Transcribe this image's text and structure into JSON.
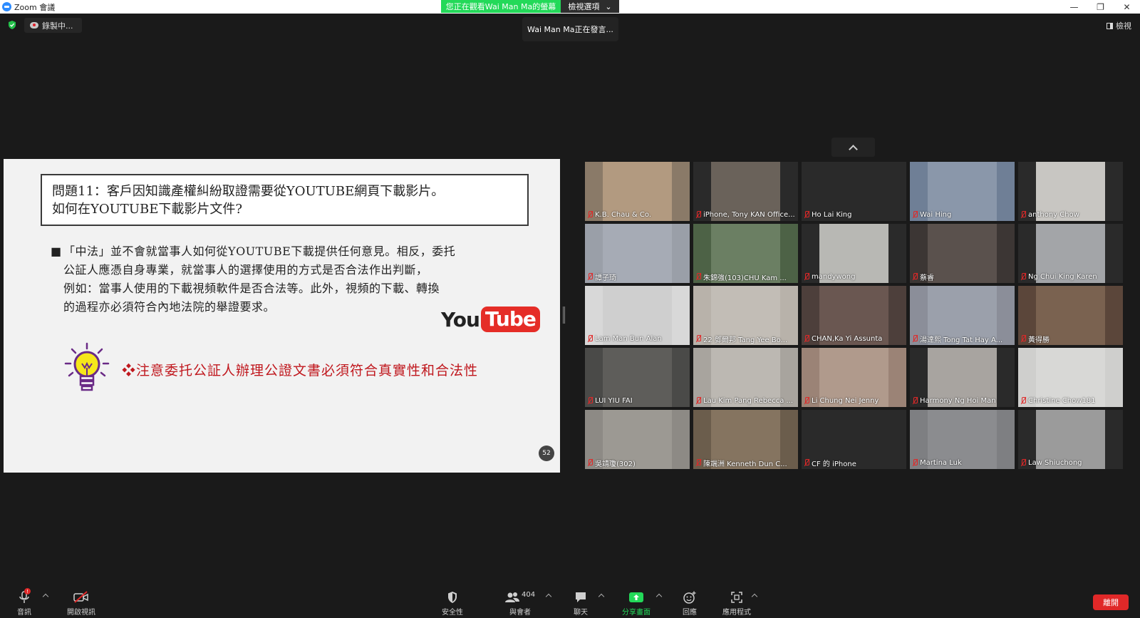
{
  "window": {
    "title": "Zoom 會議"
  },
  "banner": {
    "viewing": "您正在觀看Wai Man Ma的螢幕",
    "view_options": "檢視選項"
  },
  "speaker_tag": "Wai Man Ma正在發言...",
  "recording_label": "錄製中...",
  "view_label": "檢視",
  "slide": {
    "question_line1": "問題11：客戶因知識產權糾紛取證需要從YOUTUBE網頁下載影片。",
    "question_line2": "如何在YOUTUBE下載影片文件?",
    "bullet_mark": "■",
    "bullet_lines": [
      "「中法」並不會就當事人如何從YOUTUBE下載提供任何意見。相反，委托",
      "公証人應憑自身專業，就當事人的選擇使用的方式是否合法作出判斷，",
      "例如：當事人使用的下載視頻軟件是否合法等。此外，視頻的下載、轉換",
      "的過程亦必須符合內地法院的舉證要求。"
    ],
    "logo_you": "You",
    "logo_tube": "Tube",
    "notice": "❖注意委托公証人辦理公證文書必須符合真實性和合法性",
    "page_number": "52",
    "colors": {
      "notice": "#c0181e",
      "youtube": "#e52d27"
    }
  },
  "participants": [
    {
      "name": "K.B. Chau & Co.",
      "bg": "#8a7a68",
      "img": "#b29a80"
    },
    {
      "name": "iPhone, Tony KAN Office...",
      "bg": "#2a2a2a",
      "img": "#6a625a"
    },
    {
      "name": "Ho Lai King",
      "bg": "#2a2a2a",
      "img": ""
    },
    {
      "name": "Wai Hing",
      "bg": "#6f7f96",
      "img": "#8a97aa"
    },
    {
      "name": "anthony Chow",
      "bg": "#2a2a2a",
      "img": "#c8c6c2"
    },
    {
      "name": "譚子琦",
      "bg": "#9a9fa8",
      "img": "#a6abb5"
    },
    {
      "name": "朱錦強(103)CHU Kam ...",
      "bg": "#4d6246",
      "img": "#6b7f63"
    },
    {
      "name": "mandywong",
      "bg": "#2a2a2a",
      "img": "#b8b8b4"
    },
    {
      "name": "蔡睿",
      "bg": "#3c3634",
      "img": "#5a514d"
    },
    {
      "name": "Ng Chui King Karen",
      "bg": "#2a2a2a",
      "img": "#a3a5a8"
    },
    {
      "name": "Lam Man Bun Alan",
      "bg": "#d8d8d8",
      "img": "#cfcfcf"
    },
    {
      "name": "22 鄧爾邦 Tang Yee Bo...",
      "bg": "#b8b2aa",
      "img": "#c2bdb6"
    },
    {
      "name": "CHAN,Ka Yi Assunta",
      "bg": "#4d3f3b",
      "img": "#6a5751"
    },
    {
      "name": "湯達熙 Tong Tat Hay A...",
      "bg": "#8b8e99",
      "img": "#9ba0ab"
    },
    {
      "name": "黃得勝",
      "bg": "#5b463a",
      "img": "#7a6250"
    },
    {
      "name": "LUI YIU FAI",
      "bg": "#4a4a48",
      "img": "#5e5d5a"
    },
    {
      "name": "Lau Kim Pang Rebecca ...",
      "bg": "#a8a49e",
      "img": "#bcb8b2"
    },
    {
      "name": "Li Chung Nei Jenny",
      "bg": "#9b8376",
      "img": "#b09a8c"
    },
    {
      "name": "Harmony Ng Hoi Man",
      "bg": "#2a2a2a",
      "img": "#a8a4a0"
    },
    {
      "name": "Christine Chow181",
      "bg": "#cfcfcd",
      "img": "#d8d8d6"
    },
    {
      "name": "吳靖瓊(302)",
      "bg": "#8d8a85",
      "img": "#9c9993"
    },
    {
      "name": "陳端洲 Kenneth Dun C...",
      "bg": "#6b5d4c",
      "img": "#857460"
    },
    {
      "name": "CF 的 iPhone",
      "bg": "#2a2a2a",
      "img": ""
    },
    {
      "name": "Martina Luk",
      "bg": "#7e7f82",
      "img": "#8b8c8f"
    },
    {
      "name": "Law Shiuchong",
      "bg": "#2a2a2a",
      "img": "#9b9b9b"
    }
  ],
  "toolbar": {
    "audio": "音訊",
    "video": "開啟視訊",
    "security": "安全性",
    "participants": "與會者",
    "participant_count": "404",
    "chat": "聊天",
    "share": "分享畫面",
    "reactions": "回應",
    "apps": "應用程式",
    "leave": "離開"
  }
}
